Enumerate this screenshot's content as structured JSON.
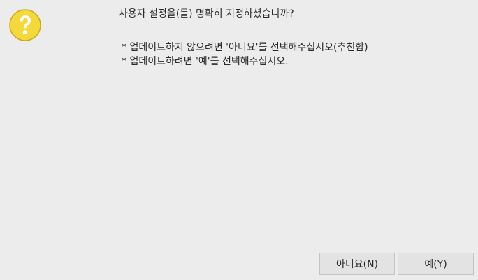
{
  "dialog": {
    "icon": "question-icon",
    "icon_color": "#f5d93a",
    "question": "사용자 설정을(를) 명확히 지정하셨습니까?",
    "note_no": "* 업데이트하지 않으려면 '아니요'를 선택해주십시오(추천함)",
    "note_yes": "* 업데이트하려면 '예'를 선택해주십시오.",
    "buttons": {
      "no_label": "아니요(N)",
      "yes_label": "예(Y)"
    }
  }
}
